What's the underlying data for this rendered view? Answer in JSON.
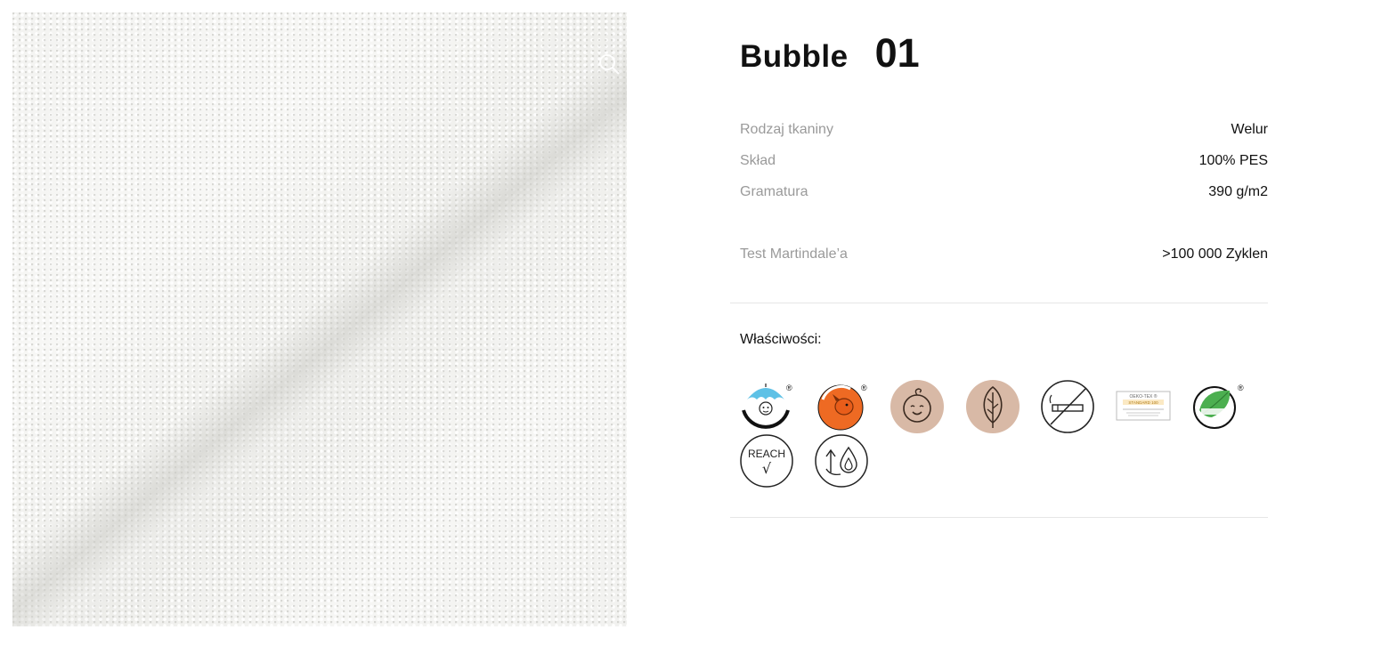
{
  "product": {
    "name": "Bubble",
    "number": "01"
  },
  "specs": [
    {
      "label": "Rodzaj tkaniny",
      "value": "Welur"
    },
    {
      "label": "Skład",
      "value": "100% PES"
    },
    {
      "label": "Gramatura",
      "value": "390 g/m2"
    },
    {
      "label": "Test Martindale’a",
      "value": ">100 000 Zyklen"
    }
  ],
  "properties": {
    "label": "Właściwości:",
    "icons": [
      {
        "name": "child-safe-umbrella-icon",
        "text": "BEZPIECZNY DLA DZIECKA",
        "mark": "®"
      },
      {
        "name": "pet-friendly-icon",
        "text": "DLA ZWIERZĄT PRZYJAZNY",
        "mark": "®"
      },
      {
        "name": "baby-face-icon"
      },
      {
        "name": "leaf-icon"
      },
      {
        "name": "no-smoking-icon"
      },
      {
        "name": "oeko-tex-label-icon",
        "text": "OEKO-TEX ® STANDARD 100"
      },
      {
        "name": "human-friendly-leaf-icon",
        "text": "PRZYJAZNY DLA CZŁOWIEKA",
        "mark": "®"
      },
      {
        "name": "reach-check-icon",
        "text": "REACH",
        "check": "√"
      },
      {
        "name": "water-repellent-icon"
      }
    ]
  },
  "colors": {
    "badge_beige": "#d8b9a6",
    "orange": "#ee6a23",
    "sky_blue": "#5ec1e6",
    "leaf_green": "#4caf50"
  }
}
